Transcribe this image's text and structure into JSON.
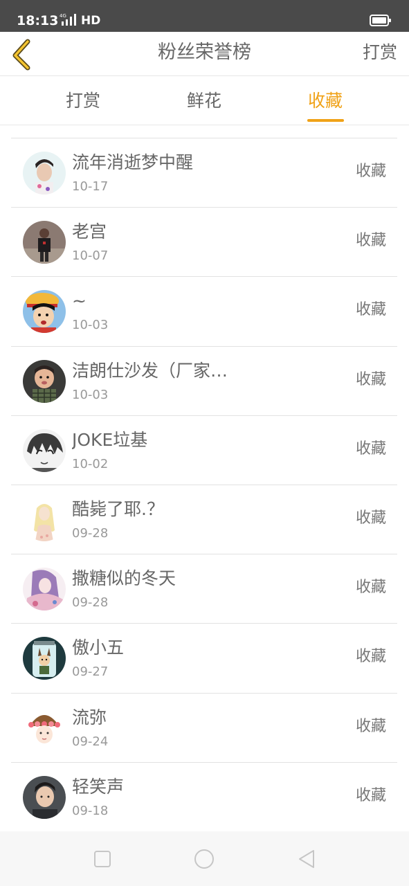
{
  "status_bar": {
    "time": "18:13",
    "network": "HD",
    "network_type": "4G"
  },
  "header": {
    "title": "粉丝荣誉榜",
    "action_label": "打赏",
    "accent_color": "#f0a218"
  },
  "tabs": [
    {
      "label": "打赏",
      "active": false
    },
    {
      "label": "鲜花",
      "active": false
    },
    {
      "label": "收藏",
      "active": true
    }
  ],
  "fans": [
    {
      "name": "流年消逝梦中醒",
      "date": "10-17",
      "action": "收藏",
      "avatar": "avatar-young-man-photo"
    },
    {
      "name": "老宫",
      "date": "10-07",
      "action": "收藏",
      "avatar": "avatar-man-standing-photo"
    },
    {
      "name": "~",
      "date": "10-03",
      "action": "收藏",
      "avatar": "avatar-cartoon-boy-straw-hat"
    },
    {
      "name": "洁朗仕沙发（厂家…",
      "date": "10-03",
      "action": "收藏",
      "avatar": "avatar-baby-photo"
    },
    {
      "name": "JOKE垃基",
      "date": "10-02",
      "action": "收藏",
      "avatar": "avatar-manga-sketch"
    },
    {
      "name": "酷毙了耶.？",
      "date": "09-28",
      "action": "收藏",
      "avatar": "avatar-blonde-girl-drawing"
    },
    {
      "name": "撒糖似的冬天",
      "date": "09-28",
      "action": "收藏",
      "avatar": "avatar-anime-girl-purple"
    },
    {
      "name": "傲小五",
      "date": "09-27",
      "action": "收藏",
      "avatar": "avatar-bunny-jar-cartoon"
    },
    {
      "name": "流弥",
      "date": "09-24",
      "action": "收藏",
      "avatar": "avatar-flower-crown-girl"
    },
    {
      "name": "轻笑声",
      "date": "09-18",
      "action": "收藏",
      "avatar": "avatar-young-man-portrait"
    }
  ]
}
